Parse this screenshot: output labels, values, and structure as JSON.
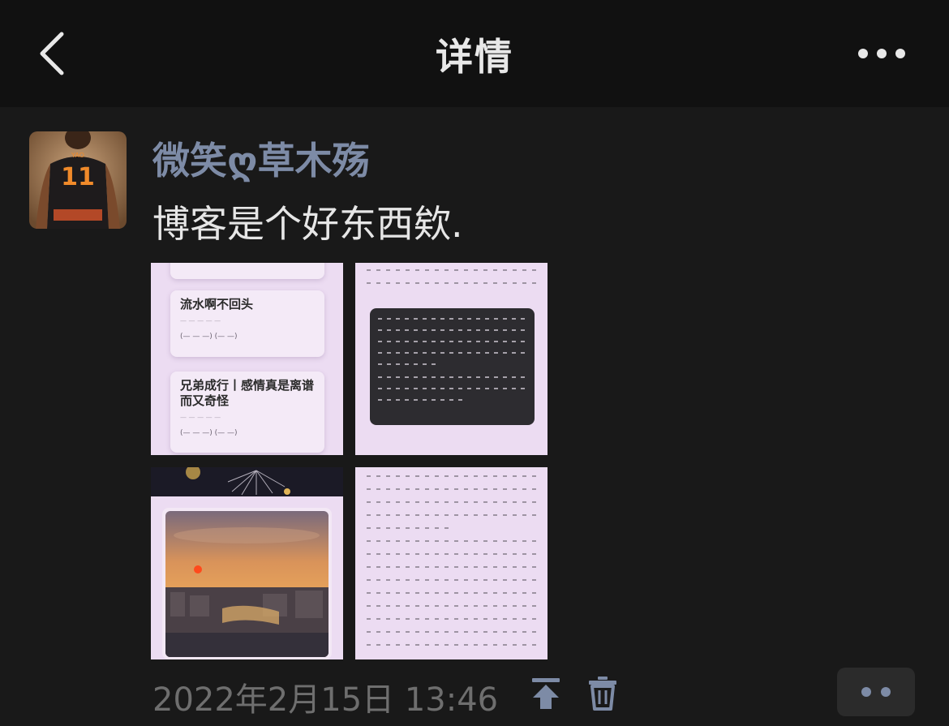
{
  "navbar": {
    "title": "详情",
    "back_icon": "chevron-left-icon",
    "more_icon": "more-horizontal-icon"
  },
  "post": {
    "username": "微笑ღ草木殇",
    "text": "博客是个好东西欸.",
    "timestamp": "2022年2月15日 13:46",
    "images": [
      {
        "kind": "article-list-screenshot",
        "items": [
          {
            "title": "流水啊不回头"
          },
          {
            "title": "兄弟成行丨感情真是离谱而又奇怪"
          }
        ]
      },
      {
        "kind": "text-screenshot-with-dark-card"
      },
      {
        "kind": "sunset-photo-screenshot"
      },
      {
        "kind": "handwritten-text-screenshot"
      }
    ]
  },
  "footer": {
    "pin_icon": "pin-to-top-icon",
    "delete_icon": "trash-icon",
    "action_icon": "two-dots-icon"
  },
  "colors": {
    "background": "#191919",
    "navbar": "#111111",
    "username": "#7d8ba6",
    "timestamp": "#6e6e6e",
    "thumb_bg": "#ecdcf2"
  }
}
